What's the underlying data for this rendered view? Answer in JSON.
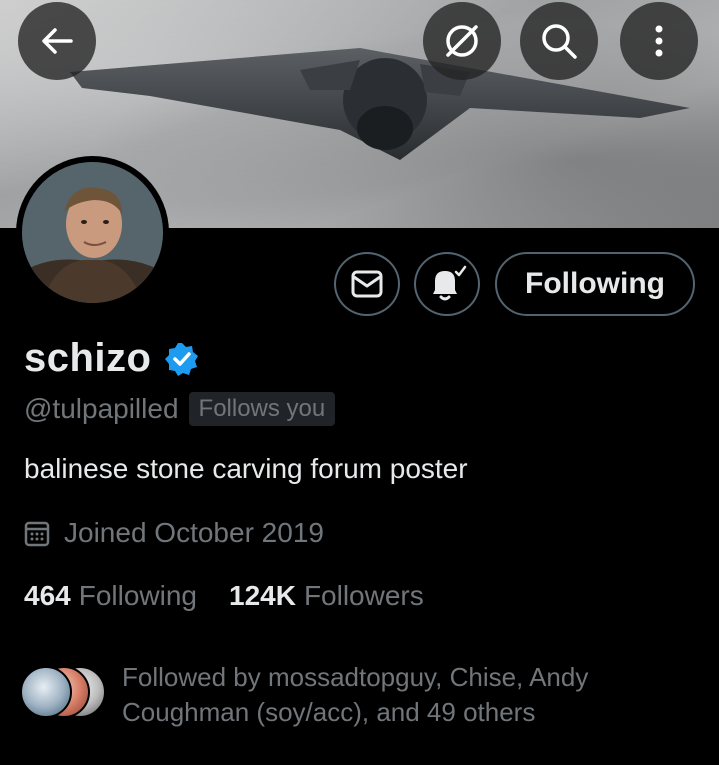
{
  "header": {
    "back_icon": "arrow-left-icon",
    "grok_icon": "slash-circle-icon",
    "search_icon": "search-icon",
    "more_icon": "more-vertical-icon"
  },
  "profile": {
    "name": "schizo",
    "verified": true,
    "handle": "@tulpapilled",
    "follows_you": "Follows you",
    "bio": "balinese stone carving forum poster",
    "joined": "Joined October 2019"
  },
  "actions": {
    "message_icon": "envelope-icon",
    "notify_icon": "bell-check-icon",
    "following_label": "Following"
  },
  "stats": {
    "following_count": "464",
    "following_label": "Following",
    "followers_count": "124K",
    "followers_label": "Followers"
  },
  "followed_by": {
    "text": "Followed by mossadtopguy, Chise, Andy Coughman (soy/acc), and 49 others"
  },
  "colors": {
    "background": "#000000",
    "primary_text": "#e7e9ea",
    "secondary_text": "#71767b",
    "border": "#536471",
    "verified_blue": "#1d9bf0"
  }
}
